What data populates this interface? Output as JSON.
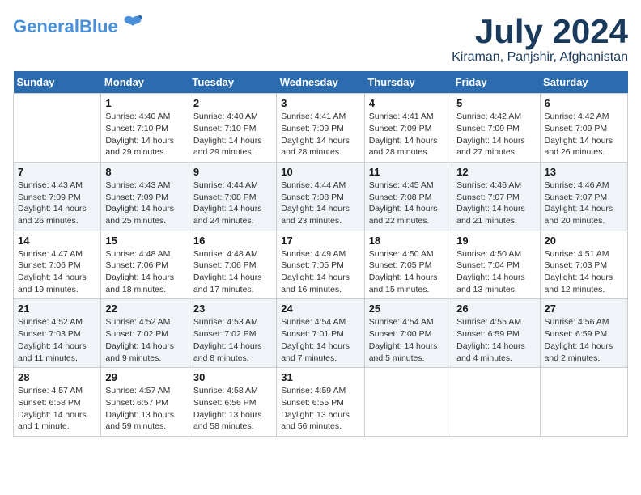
{
  "logo": {
    "general": "General",
    "blue": "Blue"
  },
  "header": {
    "month": "July 2024",
    "location": "Kiraman, Panjshir, Afghanistan"
  },
  "weekdays": [
    "Sunday",
    "Monday",
    "Tuesday",
    "Wednesday",
    "Thursday",
    "Friday",
    "Saturday"
  ],
  "weeks": [
    [
      {
        "day": "",
        "info": ""
      },
      {
        "day": "1",
        "info": "Sunrise: 4:40 AM\nSunset: 7:10 PM\nDaylight: 14 hours\nand 29 minutes."
      },
      {
        "day": "2",
        "info": "Sunrise: 4:40 AM\nSunset: 7:10 PM\nDaylight: 14 hours\nand 29 minutes."
      },
      {
        "day": "3",
        "info": "Sunrise: 4:41 AM\nSunset: 7:09 PM\nDaylight: 14 hours\nand 28 minutes."
      },
      {
        "day": "4",
        "info": "Sunrise: 4:41 AM\nSunset: 7:09 PM\nDaylight: 14 hours\nand 28 minutes."
      },
      {
        "day": "5",
        "info": "Sunrise: 4:42 AM\nSunset: 7:09 PM\nDaylight: 14 hours\nand 27 minutes."
      },
      {
        "day": "6",
        "info": "Sunrise: 4:42 AM\nSunset: 7:09 PM\nDaylight: 14 hours\nand 26 minutes."
      }
    ],
    [
      {
        "day": "7",
        "info": "Sunrise: 4:43 AM\nSunset: 7:09 PM\nDaylight: 14 hours\nand 26 minutes."
      },
      {
        "day": "8",
        "info": "Sunrise: 4:43 AM\nSunset: 7:09 PM\nDaylight: 14 hours\nand 25 minutes."
      },
      {
        "day": "9",
        "info": "Sunrise: 4:44 AM\nSunset: 7:08 PM\nDaylight: 14 hours\nand 24 minutes."
      },
      {
        "day": "10",
        "info": "Sunrise: 4:44 AM\nSunset: 7:08 PM\nDaylight: 14 hours\nand 23 minutes."
      },
      {
        "day": "11",
        "info": "Sunrise: 4:45 AM\nSunset: 7:08 PM\nDaylight: 14 hours\nand 22 minutes."
      },
      {
        "day": "12",
        "info": "Sunrise: 4:46 AM\nSunset: 7:07 PM\nDaylight: 14 hours\nand 21 minutes."
      },
      {
        "day": "13",
        "info": "Sunrise: 4:46 AM\nSunset: 7:07 PM\nDaylight: 14 hours\nand 20 minutes."
      }
    ],
    [
      {
        "day": "14",
        "info": "Sunrise: 4:47 AM\nSunset: 7:06 PM\nDaylight: 14 hours\nand 19 minutes."
      },
      {
        "day": "15",
        "info": "Sunrise: 4:48 AM\nSunset: 7:06 PM\nDaylight: 14 hours\nand 18 minutes."
      },
      {
        "day": "16",
        "info": "Sunrise: 4:48 AM\nSunset: 7:06 PM\nDaylight: 14 hours\nand 17 minutes."
      },
      {
        "day": "17",
        "info": "Sunrise: 4:49 AM\nSunset: 7:05 PM\nDaylight: 14 hours\nand 16 minutes."
      },
      {
        "day": "18",
        "info": "Sunrise: 4:50 AM\nSunset: 7:05 PM\nDaylight: 14 hours\nand 15 minutes."
      },
      {
        "day": "19",
        "info": "Sunrise: 4:50 AM\nSunset: 7:04 PM\nDaylight: 14 hours\nand 13 minutes."
      },
      {
        "day": "20",
        "info": "Sunrise: 4:51 AM\nSunset: 7:03 PM\nDaylight: 14 hours\nand 12 minutes."
      }
    ],
    [
      {
        "day": "21",
        "info": "Sunrise: 4:52 AM\nSunset: 7:03 PM\nDaylight: 14 hours\nand 11 minutes."
      },
      {
        "day": "22",
        "info": "Sunrise: 4:52 AM\nSunset: 7:02 PM\nDaylight: 14 hours\nand 9 minutes."
      },
      {
        "day": "23",
        "info": "Sunrise: 4:53 AM\nSunset: 7:02 PM\nDaylight: 14 hours\nand 8 minutes."
      },
      {
        "day": "24",
        "info": "Sunrise: 4:54 AM\nSunset: 7:01 PM\nDaylight: 14 hours\nand 7 minutes."
      },
      {
        "day": "25",
        "info": "Sunrise: 4:54 AM\nSunset: 7:00 PM\nDaylight: 14 hours\nand 5 minutes."
      },
      {
        "day": "26",
        "info": "Sunrise: 4:55 AM\nSunset: 6:59 PM\nDaylight: 14 hours\nand 4 minutes."
      },
      {
        "day": "27",
        "info": "Sunrise: 4:56 AM\nSunset: 6:59 PM\nDaylight: 14 hours\nand 2 minutes."
      }
    ],
    [
      {
        "day": "28",
        "info": "Sunrise: 4:57 AM\nSunset: 6:58 PM\nDaylight: 14 hours\nand 1 minute."
      },
      {
        "day": "29",
        "info": "Sunrise: 4:57 AM\nSunset: 6:57 PM\nDaylight: 13 hours\nand 59 minutes."
      },
      {
        "day": "30",
        "info": "Sunrise: 4:58 AM\nSunset: 6:56 PM\nDaylight: 13 hours\nand 58 minutes."
      },
      {
        "day": "31",
        "info": "Sunrise: 4:59 AM\nSunset: 6:55 PM\nDaylight: 13 hours\nand 56 minutes."
      },
      {
        "day": "",
        "info": ""
      },
      {
        "day": "",
        "info": ""
      },
      {
        "day": "",
        "info": ""
      }
    ]
  ]
}
